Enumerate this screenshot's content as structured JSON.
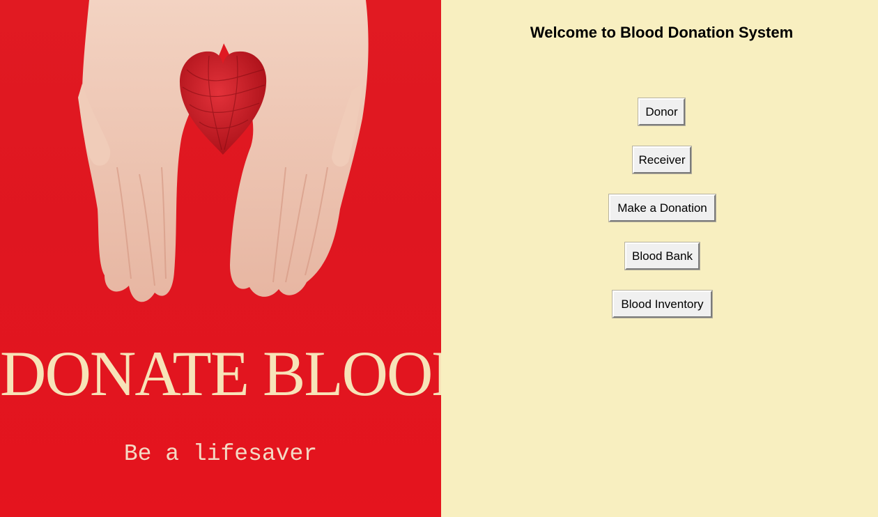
{
  "poster": {
    "headline": "DONATE BLOOD",
    "tagline": "Be a lifesaver",
    "image": "hands-holding-heart-icon",
    "colors": {
      "background": "#e11a22",
      "headline": "#f7e3b8"
    }
  },
  "panel": {
    "title": "Welcome to Blood Donation System",
    "background": "#f8efc0",
    "buttons": [
      {
        "label": "Donor"
      },
      {
        "label": "Receiver"
      },
      {
        "label": "Make a Donation"
      },
      {
        "label": "Blood Bank"
      },
      {
        "label": "Blood Inventory"
      }
    ]
  }
}
